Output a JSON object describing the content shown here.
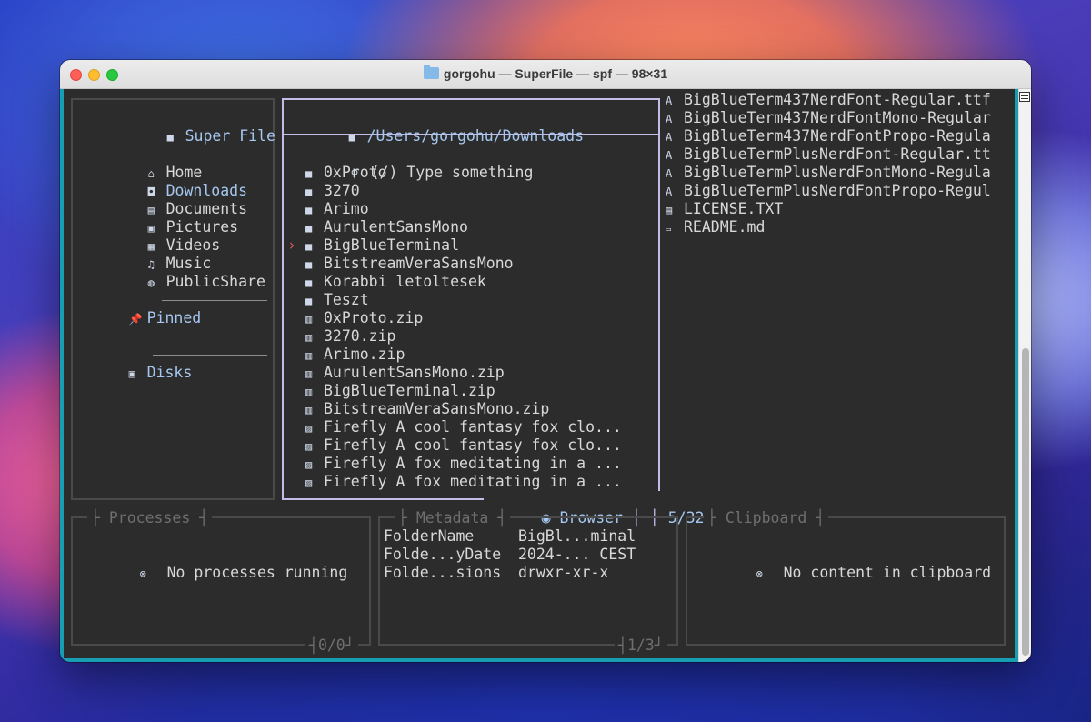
{
  "window": {
    "title": "gorgohu — SuperFile — spf — 98×31"
  },
  "sidebar": {
    "title": "Super File",
    "items": [
      {
        "label": "Home",
        "icon": "home-icon"
      },
      {
        "label": "Downloads",
        "icon": "download-icon"
      },
      {
        "label": "Documents",
        "icon": "document-icon"
      },
      {
        "label": "Pictures",
        "icon": "picture-icon"
      },
      {
        "label": "Videos",
        "icon": "video-icon"
      },
      {
        "label": "Music",
        "icon": "music-icon"
      },
      {
        "label": "PublicShare",
        "icon": "globe-icon"
      }
    ],
    "pinned_label": "Pinned",
    "disks_label": "Disks"
  },
  "file_panel": {
    "path": "/Users/gorgohu/Downloads",
    "search_placeholder": "(/) Type something",
    "cursor": "›",
    "entries": [
      {
        "name": "0xProto",
        "type": "folder"
      },
      {
        "name": "3270",
        "type": "folder"
      },
      {
        "name": "Arimo",
        "type": "folder"
      },
      {
        "name": "AurulentSansMono",
        "type": "folder"
      },
      {
        "name": "BigBlueTerminal",
        "type": "folder",
        "selected": true
      },
      {
        "name": "BitstreamVeraSansMono",
        "type": "folder"
      },
      {
        "name": "Korabbi letoltesek",
        "type": "folder"
      },
      {
        "name": "Teszt",
        "type": "folder"
      },
      {
        "name": "0xProto.zip",
        "type": "zip"
      },
      {
        "name": "3270.zip",
        "type": "zip"
      },
      {
        "name": "Arimo.zip",
        "type": "zip"
      },
      {
        "name": "AurulentSansMono.zip",
        "type": "zip"
      },
      {
        "name": "BigBlueTerminal.zip",
        "type": "zip"
      },
      {
        "name": "BitstreamVeraSansMono.zip",
        "type": "zip"
      },
      {
        "name": "Firefly A cool fantasy fox clo...",
        "type": "image"
      },
      {
        "name": "Firefly A cool fantasy fox clo...",
        "type": "image"
      },
      {
        "name": "Firefly A fox meditating in a ...",
        "type": "image"
      },
      {
        "name": "Firefly A fox meditating in a ...",
        "type": "image"
      }
    ],
    "mode_label": "Browser",
    "position": "5/32"
  },
  "preview": {
    "items": [
      {
        "name": "BigBlueTerm437NerdFont-Regular.ttf",
        "type": "font"
      },
      {
        "name": "BigBlueTerm437NerdFontMono-Regular",
        "type": "font"
      },
      {
        "name": "BigBlueTerm437NerdFontPropo-Regula",
        "type": "font"
      },
      {
        "name": "BigBlueTermPlusNerdFont-Regular.tt",
        "type": "font"
      },
      {
        "name": "BigBlueTermPlusNerdFontMono-Regula",
        "type": "font"
      },
      {
        "name": "BigBlueTermPlusNerdFontPropo-Regul",
        "type": "font"
      },
      {
        "name": "LICENSE.TXT",
        "type": "text"
      },
      {
        "name": "README.md",
        "type": "markdown"
      }
    ]
  },
  "processes": {
    "title": "Processes",
    "empty_text": "No processes running",
    "count": "0/0"
  },
  "metadata": {
    "title": "Metadata",
    "rows": [
      {
        "key": "FolderName",
        "value": "BigBl...minal"
      },
      {
        "key": "Folde...yDate",
        "value": "2024-... CEST"
      },
      {
        "key": "Folde...sions",
        "value": "drwxr-xr-x"
      }
    ],
    "count": "1/3"
  },
  "clipboard": {
    "title": "Clipboard",
    "empty_text": "No content in clipboard"
  },
  "colors": {
    "border_active": "#c6bce8",
    "accent": "#a6c8f0",
    "zip": "#e05858",
    "terminal_frame": "#179eb2"
  }
}
